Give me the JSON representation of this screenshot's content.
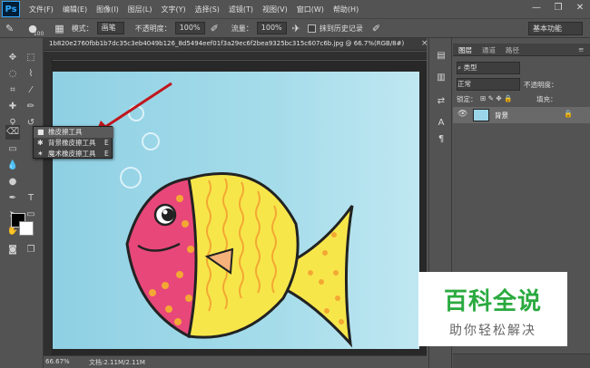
{
  "app": {
    "logo": "Ps"
  },
  "menu": [
    "文件(F)",
    "编辑(E)",
    "图像(I)",
    "图层(L)",
    "文字(Y)",
    "选择(S)",
    "滤镜(T)",
    "视图(V)",
    "窗口(W)",
    "帮助(H)"
  ],
  "window_controls": {
    "minimize": "—",
    "restore": "❐",
    "close": "✕"
  },
  "options": {
    "brush_size": "100",
    "mode_label": "模式：",
    "mode_value": "画笔",
    "opacity_label": "不透明度：",
    "opacity_value": "100%",
    "flow_label": "流量：",
    "flow_value": "100%",
    "erase_history_label": "抹到历史记录",
    "workspace": "基本功能"
  },
  "document": {
    "tab_title": "1b820e2760fbb1b7dc35c3eb4049b126_8d5494eef01f3a29ec6f2bea9325bc315c607c6b.jpg @ 66.7%(RGB/8#)",
    "close": "×"
  },
  "status": {
    "zoom": "66.67%",
    "doc_size": "文档:2.11M/2.11M"
  },
  "flyout": [
    {
      "label": "橡皮擦工具",
      "shortcut": "E",
      "icon": "eraser-icon"
    },
    {
      "label": "背景橡皮擦工具",
      "shortcut": "E",
      "icon": "background-eraser-icon"
    },
    {
      "label": "魔术橡皮擦工具",
      "shortcut": "E",
      "icon": "magic-eraser-icon"
    }
  ],
  "layers_panel": {
    "tabs": [
      "图层",
      "通道",
      "路径"
    ],
    "search_placeholder": "类型",
    "blend_mode": "正常",
    "opacity_label": "不透明度：",
    "lock_label": "锁定：",
    "fill_label": "填充：",
    "layer_name": "背景"
  },
  "watermark": {
    "title": "百科全说",
    "subtitle": "助你轻松解决"
  },
  "colors": {
    "accent_arrow": "#c0161c",
    "fish_pink": "#e8477a",
    "fish_yellow": "#f7e64a",
    "canvas_blue": "#a5dcea"
  }
}
